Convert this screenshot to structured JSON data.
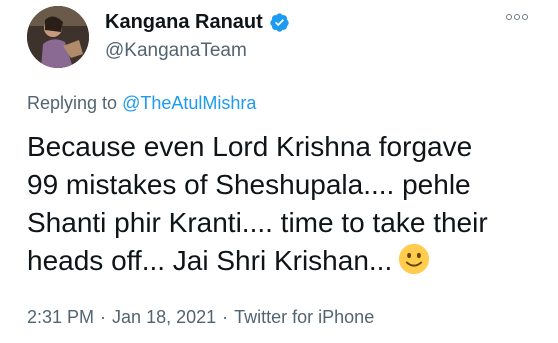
{
  "author": {
    "display_name": "Kangana Ranaut",
    "handle": "@KanganaTeam",
    "verified": true,
    "avatar_icon": "profile-photo"
  },
  "reply": {
    "prefix": "Replying to",
    "mention": "@TheAtulMishra"
  },
  "tweet": {
    "lines": [
      "Because even Lord Krishna forgave",
      "99 mistakes of Sheshupala.... pehle",
      "Shanti phir Kranti.... time to take their",
      "heads off... Jai Shri Krishan..."
    ],
    "emoji": "slightly-smiling-face"
  },
  "meta": {
    "time": "2:31 PM",
    "date": "Jan 18, 2021",
    "source": "Twitter for iPhone",
    "separator": "·"
  },
  "colors": {
    "link": "#1d9bf0",
    "secondary_text": "#536471",
    "verified_badge": "#1d9bf0"
  }
}
